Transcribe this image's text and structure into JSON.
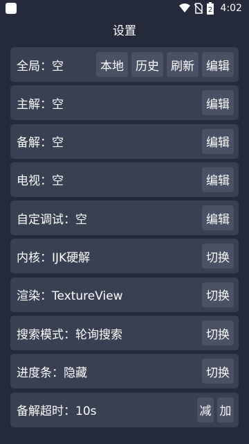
{
  "status_bar": {
    "time": "4:02",
    "battery_level": "2"
  },
  "page": {
    "title": "设置"
  },
  "rows": [
    {
      "label": "全局：空",
      "buttons": [
        "本地",
        "历史",
        "刷新",
        "编辑"
      ]
    },
    {
      "label": "主解：空",
      "buttons": [
        "编辑"
      ]
    },
    {
      "label": "备解：空",
      "buttons": [
        "编辑"
      ]
    },
    {
      "label": "电视：空",
      "buttons": [
        "编辑"
      ]
    },
    {
      "label": "自定调试：空",
      "buttons": [
        "编辑"
      ]
    },
    {
      "label": "内核：IJK硬解",
      "buttons": [
        "切换"
      ]
    },
    {
      "label": "渲染：TextureView",
      "buttons": [
        "切换"
      ]
    },
    {
      "label": "搜索模式：轮询搜索",
      "buttons": [
        "切换"
      ]
    },
    {
      "label": "进度条：隐藏",
      "buttons": [
        "切换"
      ]
    },
    {
      "label": "备解超时：10s",
      "buttons": [
        "减",
        "加"
      ]
    }
  ],
  "colors": {
    "background": "#242a3a",
    "row": "#394052",
    "button": "#4a5165"
  }
}
